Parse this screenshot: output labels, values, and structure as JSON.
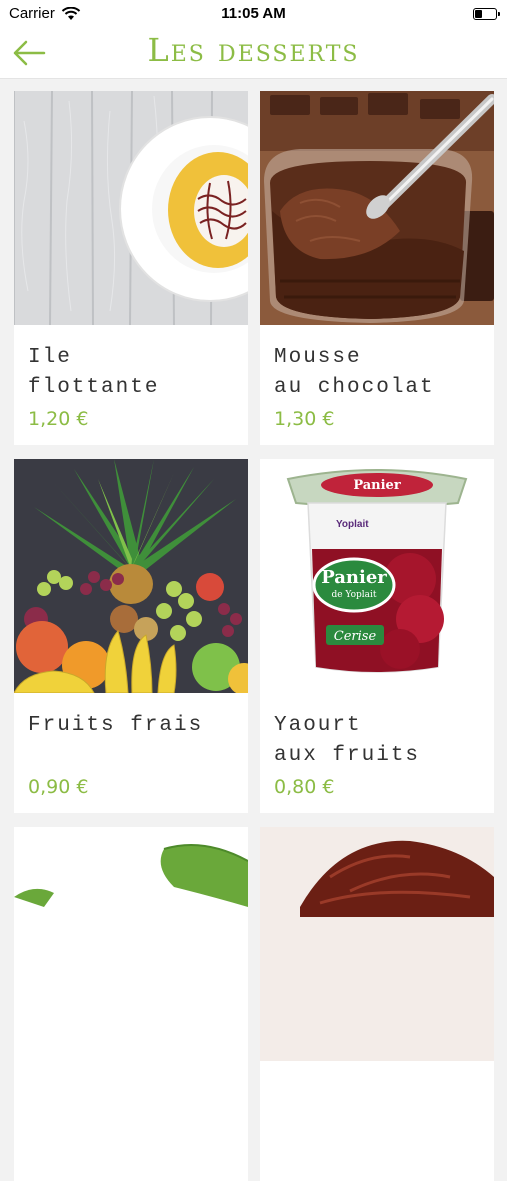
{
  "status": {
    "carrier": "Carrier",
    "time": "11:05 AM"
  },
  "nav": {
    "title": "Les desserts",
    "back_icon": "arrow-left-icon",
    "accent": "#8cbc45"
  },
  "items": [
    {
      "name": "Ile\nflottante",
      "price": "1,20 €"
    },
    {
      "name": "Mousse\nau chocolat",
      "price": "1,30 €"
    },
    {
      "name": "Fruits frais",
      "price": "0,90 €"
    },
    {
      "name": "Yaourt\naux fruits",
      "price": "0,80 €"
    },
    {
      "name": "",
      "price": ""
    },
    {
      "name": "",
      "price": ""
    }
  ],
  "yogurt_label": {
    "brand": "Panier",
    "sub": "de Yoplait",
    "flavor": "Cerise",
    "maker": "Yoplait"
  }
}
